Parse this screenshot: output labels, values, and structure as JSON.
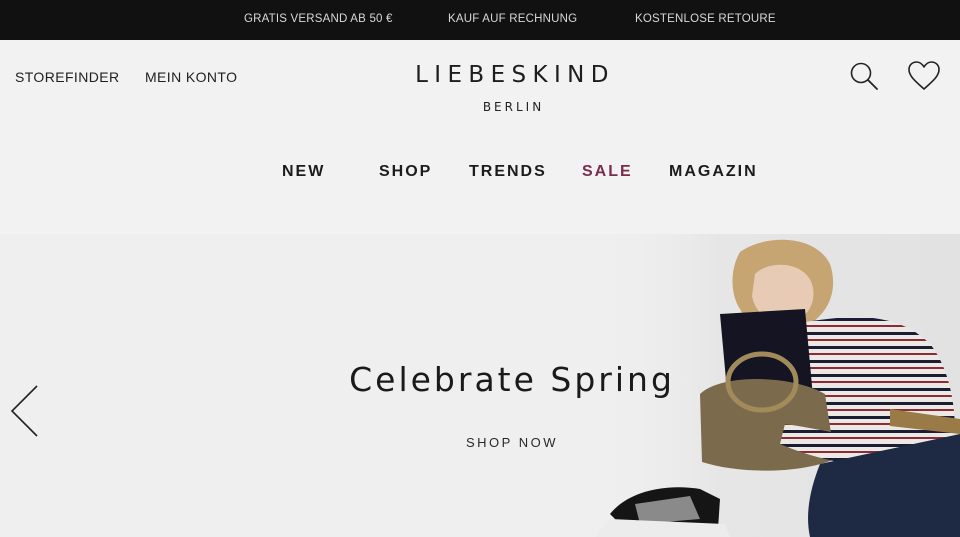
{
  "topbar": {
    "items": [
      "GRATIS VERSAND AB 50 €",
      "KAUF AUF RECHNUNG",
      "KOSTENLOSE RETOURE"
    ]
  },
  "header": {
    "storefinder": "STOREFINDER",
    "account": "MEIN KONTO",
    "brand": "LIEBESKIND",
    "city": "BERLIN",
    "icons": [
      "search-icon",
      "heart-icon"
    ]
  },
  "nav": {
    "items": [
      {
        "label": "NEW"
      },
      {
        "label": "SHOP"
      },
      {
        "label": "TRENDS"
      },
      {
        "label": "SALE",
        "color": "#7a2c4a"
      },
      {
        "label": "MAGAZIN"
      }
    ]
  },
  "hero": {
    "title": "Celebrate Spring",
    "cta": "SHOP NOW",
    "prev_icon": "chevron-left-icon"
  },
  "colors": {
    "topbar_bg": "#111111",
    "page_bg": "#f2f2f2",
    "sale": "#7a2c4a"
  }
}
